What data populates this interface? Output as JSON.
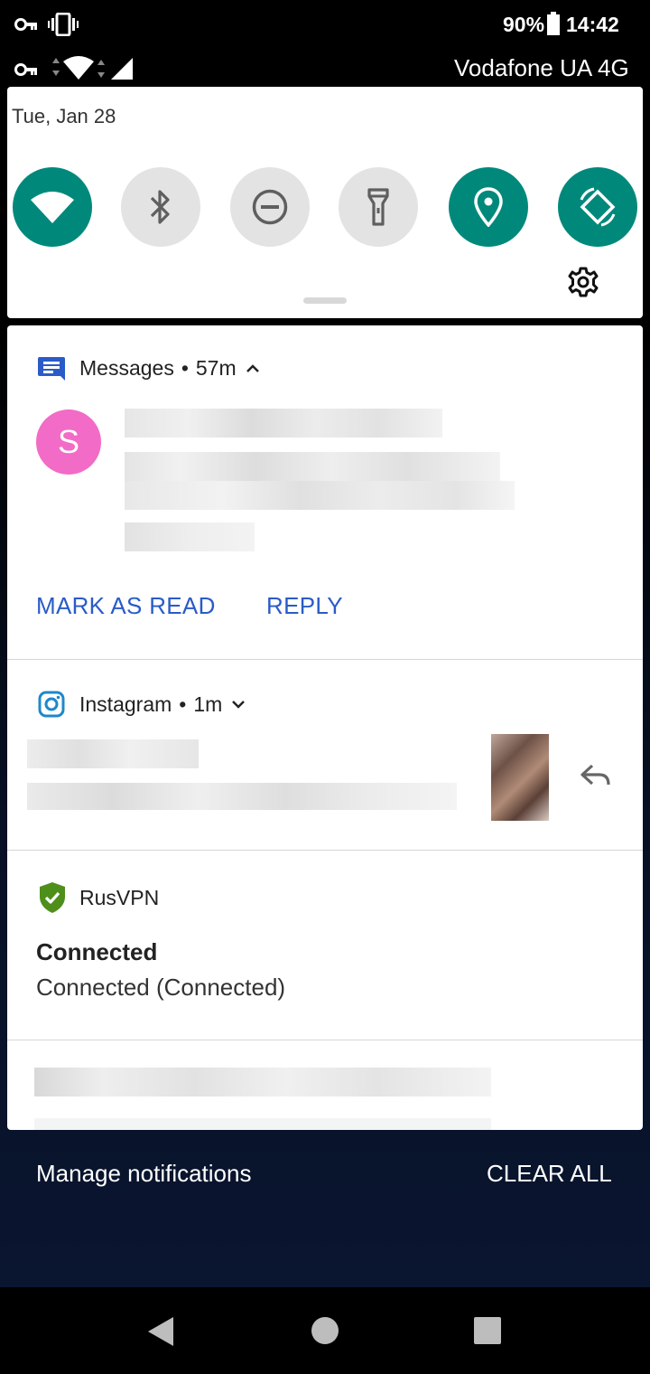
{
  "status_bar": {
    "battery": "90%",
    "time": "14:42",
    "carrier": "Vodafone UA 4G",
    "icons_row1": [
      "vpn-key-icon",
      "vibrate-icon"
    ],
    "icons_row2": [
      "vpn-key-icon",
      "wifi-icon",
      "cellular-signal-icon"
    ]
  },
  "quick_settings": {
    "date": "Tue, Jan 28",
    "tiles": [
      {
        "name": "wifi",
        "state": "on"
      },
      {
        "name": "bluetooth",
        "state": "off"
      },
      {
        "name": "do-not-disturb",
        "state": "off"
      },
      {
        "name": "flashlight",
        "state": "off"
      },
      {
        "name": "location",
        "state": "on"
      },
      {
        "name": "auto-rotate",
        "state": "on"
      }
    ],
    "active_color": "#00897b",
    "inactive_color": "#e3e3e3"
  },
  "notifications": {
    "messages": {
      "app": "Messages",
      "dot": "•",
      "time": "57m",
      "avatar_letter": "S",
      "avatar_color": "#f26bc6",
      "actions": [
        "MARK AS READ",
        "REPLY"
      ]
    },
    "instagram": {
      "app": "Instagram",
      "dot": "•",
      "time": "1m"
    },
    "rusvpn": {
      "app": "RusVPN",
      "title": "Connected",
      "text": "Connected (Connected)"
    }
  },
  "footer": {
    "manage": "Manage notifications",
    "clear_all": "CLEAR ALL"
  },
  "accent_color": "#2a5bc7"
}
